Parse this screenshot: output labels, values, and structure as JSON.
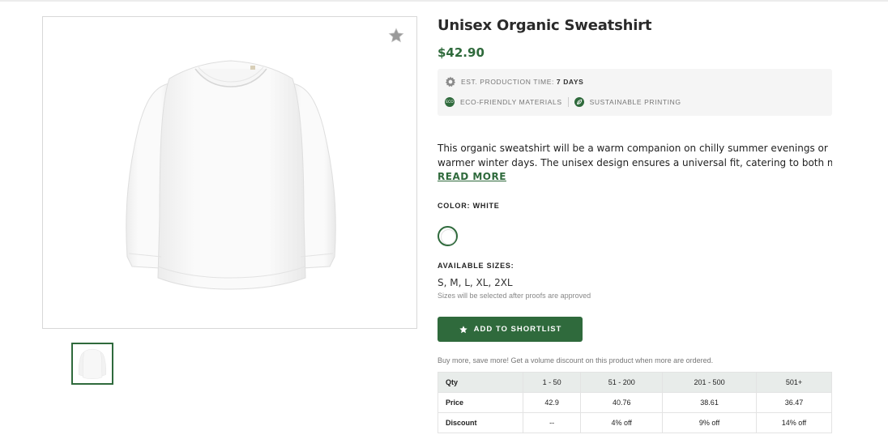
{
  "product": {
    "title": "Unisex Organic Sweatshirt",
    "price": "$42.90",
    "image_alt": "White unisex organic sweatshirt"
  },
  "info": {
    "production_label": "EST. PRODUCTION TIME:",
    "production_value": "7 DAYS",
    "eco_badge_text": "ECO",
    "eco_materials": "ECO-FRIENDLY MATERIALS",
    "sustainable_printing": "SUSTAINABLE PRINTING"
  },
  "description": {
    "line1": "This organic sweatshirt will be a warm companion on chilly summer evenings or",
    "line2": "warmer winter days. The unisex design ensures a universal fit, catering to both men…",
    "read_more": "READ MORE"
  },
  "color": {
    "label": "COLOR: WHITE",
    "selected_hex": "#ffffff"
  },
  "sizes": {
    "label": "AVAILABLE SIZES:",
    "values": "S, M, L, XL, 2XL",
    "note": "Sizes will be selected after proofs are approved"
  },
  "shortlist_button": {
    "label": "ADD TO SHORTLIST",
    "icon": "star-icon"
  },
  "volume": {
    "note": "Buy more, save more! Get a volume discount on this product when more are ordered.",
    "header": [
      "Qty",
      "1 - 50",
      "51 - 200",
      "201 - 500",
      "501+"
    ],
    "rows": [
      [
        "Price",
        "42.9",
        "40.76",
        "38.61",
        "36.47"
      ],
      [
        "Discount",
        "--",
        "4% off",
        "9% off",
        "14% off"
      ]
    ]
  },
  "colors": {
    "brand_green": "#2f6a3c",
    "info_bg": "#f5f5f5",
    "table_header_bg": "#e8ecea"
  }
}
